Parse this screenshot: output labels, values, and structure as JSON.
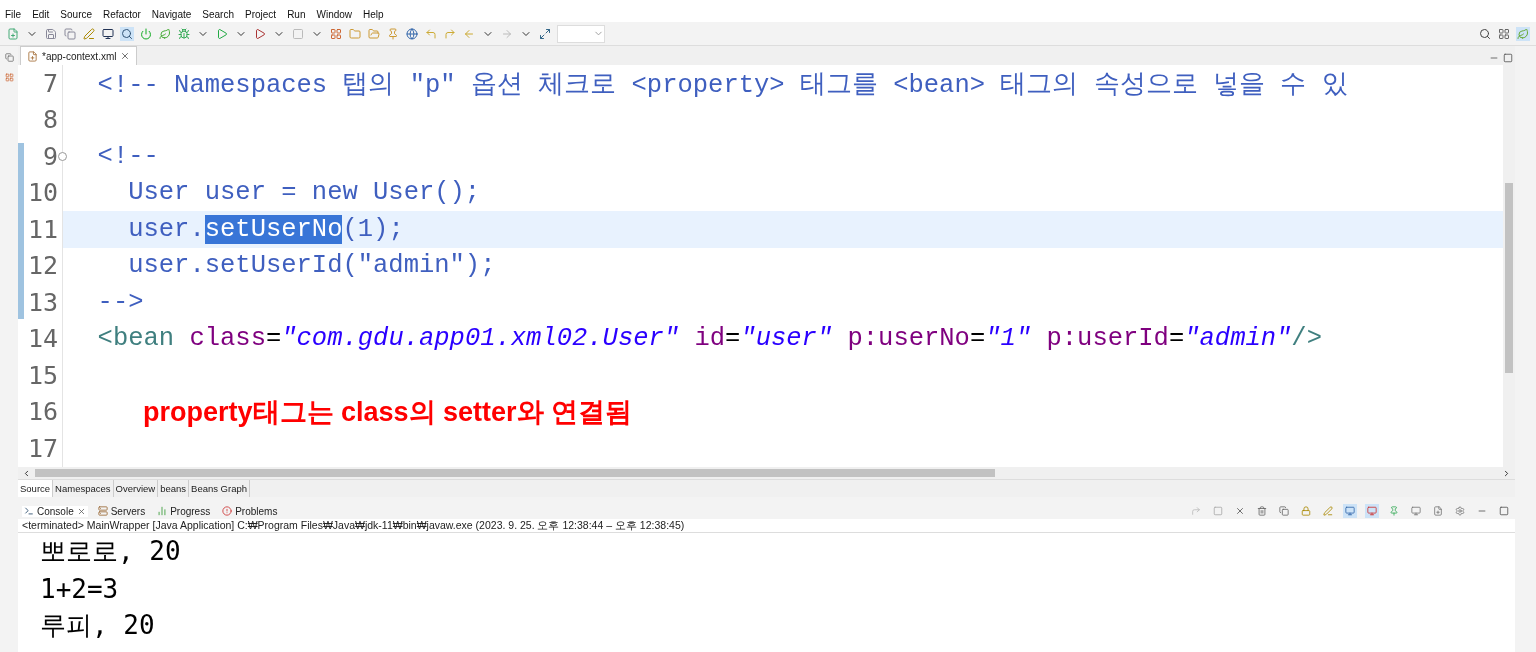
{
  "menu": [
    "File",
    "Edit",
    "Source",
    "Refactor",
    "Navigate",
    "Search",
    "Project",
    "Run",
    "Window",
    "Help"
  ],
  "editor_tab": {
    "label": "*app-context.xml"
  },
  "code_lines": [
    {
      "number": "7",
      "current": false,
      "folding": false,
      "segments": [
        {
          "kind": "comment",
          "text": "  <!-- Namespaces 탭의 \"p\" 옵션 체크로 <property> 태그를 <bean> 태그의 속성으로 넣을 수 있"
        }
      ]
    },
    {
      "number": "8",
      "current": false,
      "folding": false
    },
    {
      "number": "9",
      "current": false,
      "folding": true,
      "segments": [
        {
          "kind": "comment",
          "text": "  <!--"
        }
      ]
    },
    {
      "number": "10",
      "current": false,
      "folding": false,
      "segments": [
        {
          "kind": "comment",
          "text": "    User user = new User();"
        }
      ]
    },
    {
      "number": "11",
      "current": true,
      "folding": false,
      "segments": [
        {
          "kind": "comment",
          "text": "    user."
        },
        {
          "kind": "selection",
          "text": "setUserNo"
        },
        {
          "kind": "comment",
          "text": "(1);"
        }
      ]
    },
    {
      "number": "12",
      "current": false,
      "folding": false,
      "segments": [
        {
          "kind": "comment",
          "text": "    user.setUserId(\"admin\");"
        }
      ]
    },
    {
      "number": "13",
      "current": false,
      "folding": false,
      "segments": [
        {
          "kind": "comment",
          "text": "  -->"
        }
      ]
    },
    {
      "number": "14",
      "current": false,
      "folding": false,
      "segments": [
        {
          "kind": "tag",
          "text": "  <bean"
        },
        {
          "kind": "attr",
          "text": " class"
        },
        {
          "kind": "plain",
          "text": "="
        },
        {
          "kind": "value",
          "text": "\"com.gdu.app01.xml02.User\""
        },
        {
          "kind": "attr",
          "text": " id"
        },
        {
          "kind": "plain",
          "text": "="
        },
        {
          "kind": "value",
          "text": "\"user\""
        },
        {
          "kind": "attr",
          "text": " p:userNo"
        },
        {
          "kind": "plain",
          "text": "="
        },
        {
          "kind": "value",
          "text": "\"1\""
        },
        {
          "kind": "attr",
          "text": " p:userId"
        },
        {
          "kind": "plain",
          "text": "="
        },
        {
          "kind": "value",
          "text": "\"admin\""
        },
        {
          "kind": "tag",
          "text": "/>"
        }
      ]
    },
    {
      "number": "15",
      "current": false,
      "folding": false
    },
    {
      "number": "16",
      "current": false,
      "folding": false,
      "segments": [
        {
          "kind": "note",
          "text": "property태그는 class의 setter와 연결됨"
        }
      ]
    },
    {
      "number": "17",
      "current": false,
      "folding": false
    }
  ],
  "editor_bottom_tabs": [
    {
      "label": "Source",
      "selected": true
    },
    {
      "label": "Namespaces",
      "selected": false
    },
    {
      "label": "Overview",
      "selected": false
    },
    {
      "label": "beans",
      "selected": false
    },
    {
      "label": "Beans Graph",
      "selected": false
    }
  ],
  "console": {
    "tabs": [
      {
        "label": "Console",
        "selected": true
      },
      {
        "label": "Servers",
        "selected": false
      },
      {
        "label": "Progress",
        "selected": false
      },
      {
        "label": "Problems",
        "selected": false
      }
    ],
    "status": "<terminated> MainWrapper [Java Application] C:₩Program Files₩Java₩jdk-11₩bin₩javaw.exe  (2023. 9. 25. 오후 12:38:44 – 오후 12:38:45)",
    "output": [
      "뽀로로, 20",
      "1+2=3",
      "루피, 20"
    ]
  }
}
